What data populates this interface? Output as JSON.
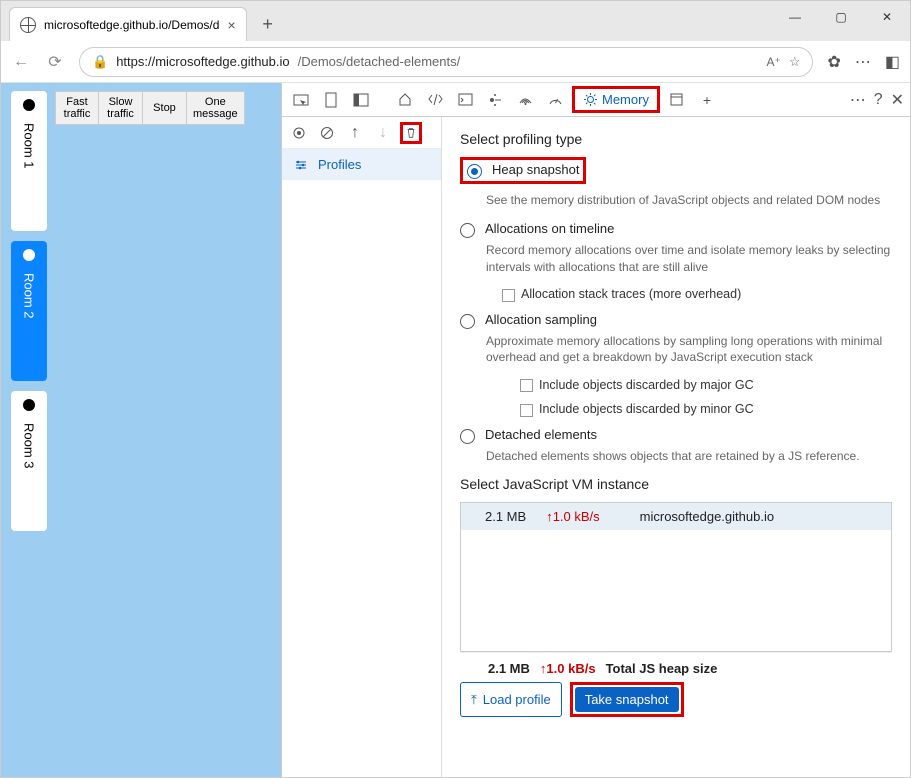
{
  "browser": {
    "tab_title": "microsoftedge.github.io/Demos/d",
    "url_host": "https://microsoftedge.github.io",
    "url_path": "/Demos/detached-elements/"
  },
  "page": {
    "rooms": [
      "Room 1",
      "Room 2",
      "Room 3"
    ],
    "buttons": [
      "Fast\ntraffic",
      "Slow\ntraffic",
      "Stop",
      "One\nmessage"
    ]
  },
  "devtools": {
    "memory_tab": "Memory",
    "profiles_label": "Profiles",
    "select_profiling": "Select profiling type",
    "heap_snapshot": {
      "label": "Heap snapshot",
      "desc": "See the memory distribution of JavaScript objects and related DOM nodes"
    },
    "alloc_timeline": {
      "label": "Allocations on timeline",
      "desc": "Record memory allocations over time and isolate memory leaks by selecting intervals with allocations that are still alive",
      "chk": "Allocation stack traces (more overhead)"
    },
    "alloc_sampling": {
      "label": "Allocation sampling",
      "desc": "Approximate memory allocations by sampling long operations with minimal overhead and get a breakdown by JavaScript execution stack",
      "chk1": "Include objects discarded by major GC",
      "chk2": "Include objects discarded by minor GC"
    },
    "detached": {
      "label": "Detached elements",
      "desc": "Detached elements shows objects that are retained by a JS reference."
    },
    "vm_title": "Select JavaScript VM instance",
    "vm_row": {
      "size": "2.1 MB",
      "rate": "↑1.0 kB/s",
      "host": "microsoftedge.github.io"
    },
    "footer": {
      "size": "2.1 MB",
      "rate": "↑1.0 kB/s",
      "label": "Total JS heap size",
      "load": "Load profile",
      "take": "Take snapshot"
    }
  }
}
